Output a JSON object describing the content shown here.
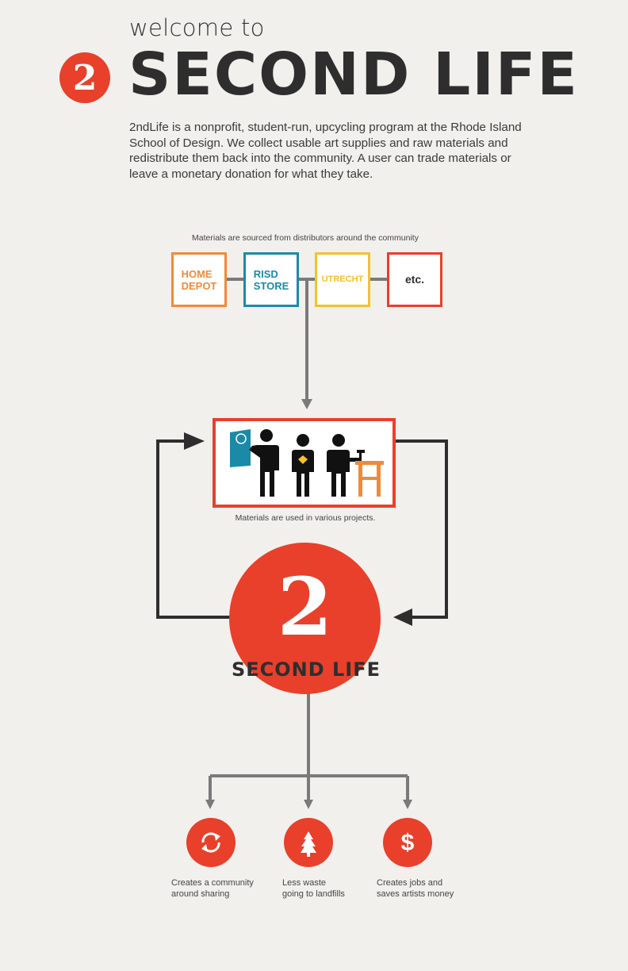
{
  "header": {
    "welcome": "welcome to",
    "logo_numeral": "2",
    "title": "SECOND LIFE",
    "intro": "2ndLife is a nonprofit, student-run, upcycling program at the Rhode Island School of Design. We collect usable art supplies and  raw materials and redistribute them back into the community. A user can trade materials or leave a monetary donation for what they take."
  },
  "sources": {
    "caption": "Materials are sourced from distributors around the community",
    "items": [
      {
        "line1": "HOME",
        "line2": "DEPOT",
        "color": "#f08a3a"
      },
      {
        "line1": "RISD",
        "line2": "STORE",
        "color": "#1a8aa8"
      },
      {
        "line1": "UTRECHT",
        "line2": "",
        "color": "#f5c12c"
      },
      {
        "line1": "etc.",
        "line2": "",
        "color": "#e8402a"
      }
    ]
  },
  "projects": {
    "caption": "Materials are used in various projects."
  },
  "hub": {
    "numeral": "2",
    "label": "SECOND LIFE"
  },
  "benefits": [
    {
      "icon": "recycle-icon",
      "line1": "Creates a community",
      "line2": "around sharing"
    },
    {
      "icon": "tree-icon",
      "line1": "Less waste",
      "line2": "going to landfills"
    },
    {
      "icon": "dollar-icon",
      "line1": "Creates jobs and",
      "line2": "saves artists money"
    }
  ],
  "colors": {
    "accent_red": "#e8402a",
    "home_depot_orange": "#f08a3a",
    "risd_blue": "#1a8aa8",
    "utrecht_yellow": "#f5c12c",
    "dark": "#2e2e2e",
    "connector_gray": "#7a7a7a"
  }
}
